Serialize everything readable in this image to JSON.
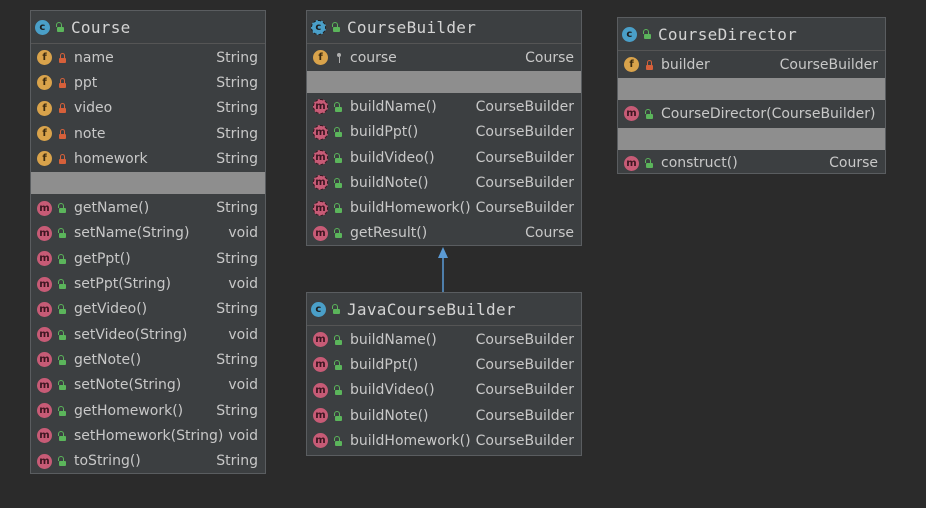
{
  "colors": {
    "background": "#2b2b2b",
    "class_bg": "#3c3f41",
    "divider": "#8e8e8e",
    "class_icon": "#4a9fc8",
    "field_icon": "#d9a34b",
    "method_icon": "#c75b76",
    "public": "#5bb55b",
    "private": "#d6603a",
    "arrow": "#5b9bd5"
  },
  "classes": {
    "course": {
      "name": "Course",
      "icon": "class-icon",
      "fields": [
        {
          "name": "name",
          "type": "String",
          "vis": "private"
        },
        {
          "name": "ppt",
          "type": "String",
          "vis": "private"
        },
        {
          "name": "video",
          "type": "String",
          "vis": "private"
        },
        {
          "name": "note",
          "type": "String",
          "vis": "private"
        },
        {
          "name": "homework",
          "type": "String",
          "vis": "private"
        }
      ],
      "methods": [
        {
          "name": "getName()",
          "type": "String"
        },
        {
          "name": "setName(String)",
          "type": "void"
        },
        {
          "name": "getPpt()",
          "type": "String"
        },
        {
          "name": "setPpt(String)",
          "type": "void"
        },
        {
          "name": "getVideo()",
          "type": "String"
        },
        {
          "name": "setVideo(String)",
          "type": "void"
        },
        {
          "name": "getNote()",
          "type": "String"
        },
        {
          "name": "setNote(String)",
          "type": "void"
        },
        {
          "name": "getHomework()",
          "type": "String"
        },
        {
          "name": "setHomework(String)",
          "type": "void"
        },
        {
          "name": "toString()",
          "type": "String"
        }
      ]
    },
    "course_builder": {
      "name": "CourseBuilder",
      "icon": "abstract-class-icon",
      "fields": [
        {
          "name": "course",
          "type": "Course",
          "vis": "package"
        }
      ],
      "methods": [
        {
          "name": "buildName()",
          "type": "CourseBuilder",
          "abstract": true
        },
        {
          "name": "buildPpt()",
          "type": "CourseBuilder",
          "abstract": true
        },
        {
          "name": "buildVideo()",
          "type": "CourseBuilder",
          "abstract": true
        },
        {
          "name": "buildNote()",
          "type": "CourseBuilder",
          "abstract": true
        },
        {
          "name": "buildHomework()",
          "type": "CourseBuilder",
          "abstract": true
        },
        {
          "name": "getResult()",
          "type": "Course",
          "abstract": false
        }
      ]
    },
    "java_course_builder": {
      "name": "JavaCourseBuilder",
      "icon": "class-icon",
      "methods": [
        {
          "name": "buildName()",
          "type": "CourseBuilder"
        },
        {
          "name": "buildPpt()",
          "type": "CourseBuilder"
        },
        {
          "name": "buildVideo()",
          "type": "CourseBuilder"
        },
        {
          "name": "buildNote()",
          "type": "CourseBuilder"
        },
        {
          "name": "buildHomework()",
          "type": "CourseBuilder"
        }
      ]
    },
    "course_director": {
      "name": "CourseDirector",
      "icon": "class-icon",
      "fields": [
        {
          "name": "builder",
          "type": "CourseBuilder",
          "vis": "private"
        }
      ],
      "constructors": [
        {
          "name": "CourseDirector(CourseBuilder)",
          "type": ""
        }
      ],
      "methods": [
        {
          "name": "construct()",
          "type": "Course"
        }
      ]
    }
  }
}
